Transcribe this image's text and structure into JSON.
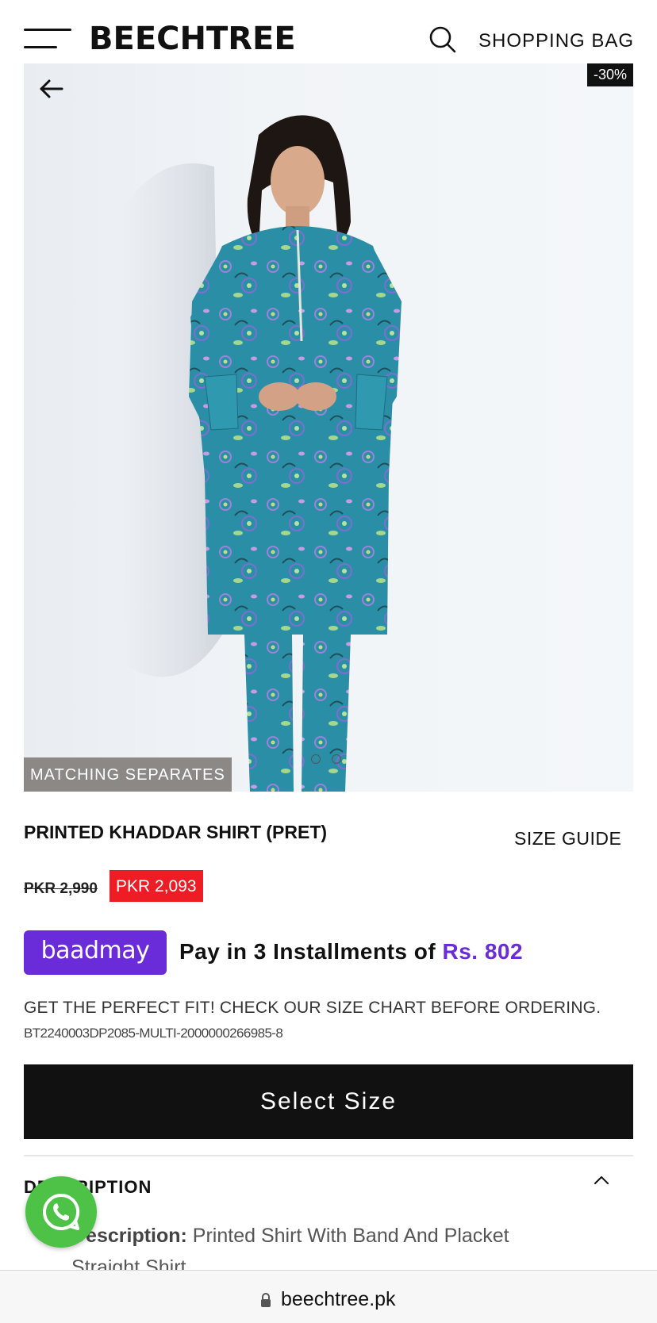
{
  "header": {
    "logo": "BEECHTREE",
    "shopping_bag_label": "SHOPPING BAG"
  },
  "product": {
    "discount_badge": "-30%",
    "collection_tag": "MATCHING SEPARATES",
    "image_dots": 2,
    "title": "PRINTED KHADDAR SHIRT (PRET)",
    "size_guide_label": "SIZE GUIDE",
    "old_price": "PKR 2,990",
    "new_price": "PKR 2,093",
    "fit_note": "GET THE PERFECT FIT! CHECK OUR SIZE CHART BEFORE ORDERING.",
    "sku": "BT2240003DP2085-MULTI-2000000266985-8",
    "select_size_label": "Select Size"
  },
  "installment": {
    "provider": "baadmay",
    "text": "Pay in 3 Installments of ",
    "amount": "Rs. 802"
  },
  "description": {
    "heading": "DESCRIPTION",
    "label": "Description:",
    "text": " Printed Shirt With Band And Placket Straight Shirt"
  },
  "browser": {
    "url": "beechtree.pk"
  },
  "colors": {
    "accent_purple": "#6a2bd9",
    "sale_red": "#ee1c25",
    "whatsapp_green": "#4dc247"
  }
}
